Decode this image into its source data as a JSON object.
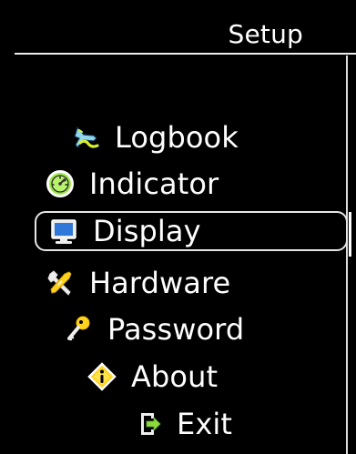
{
  "header": {
    "title": "Setup"
  },
  "menu": {
    "items": [
      {
        "label": "Logbook",
        "icon": "airplane-icon",
        "selected": false
      },
      {
        "label": "Indicator",
        "icon": "gauge-icon",
        "selected": false
      },
      {
        "label": "Display",
        "icon": "monitor-icon",
        "selected": true
      },
      {
        "label": "Hardware",
        "icon": "tools-icon",
        "selected": false
      },
      {
        "label": "Password",
        "icon": "key-icon",
        "selected": false
      },
      {
        "label": "About",
        "icon": "info-icon",
        "selected": false
      },
      {
        "label": "Exit",
        "icon": "exit-icon",
        "selected": false
      }
    ]
  },
  "colors": {
    "background": "#000000",
    "text": "#ffffff",
    "selection_border": "#e7e7e7",
    "accent_green": "#9fe84b",
    "accent_yellow": "#ffd21f"
  }
}
